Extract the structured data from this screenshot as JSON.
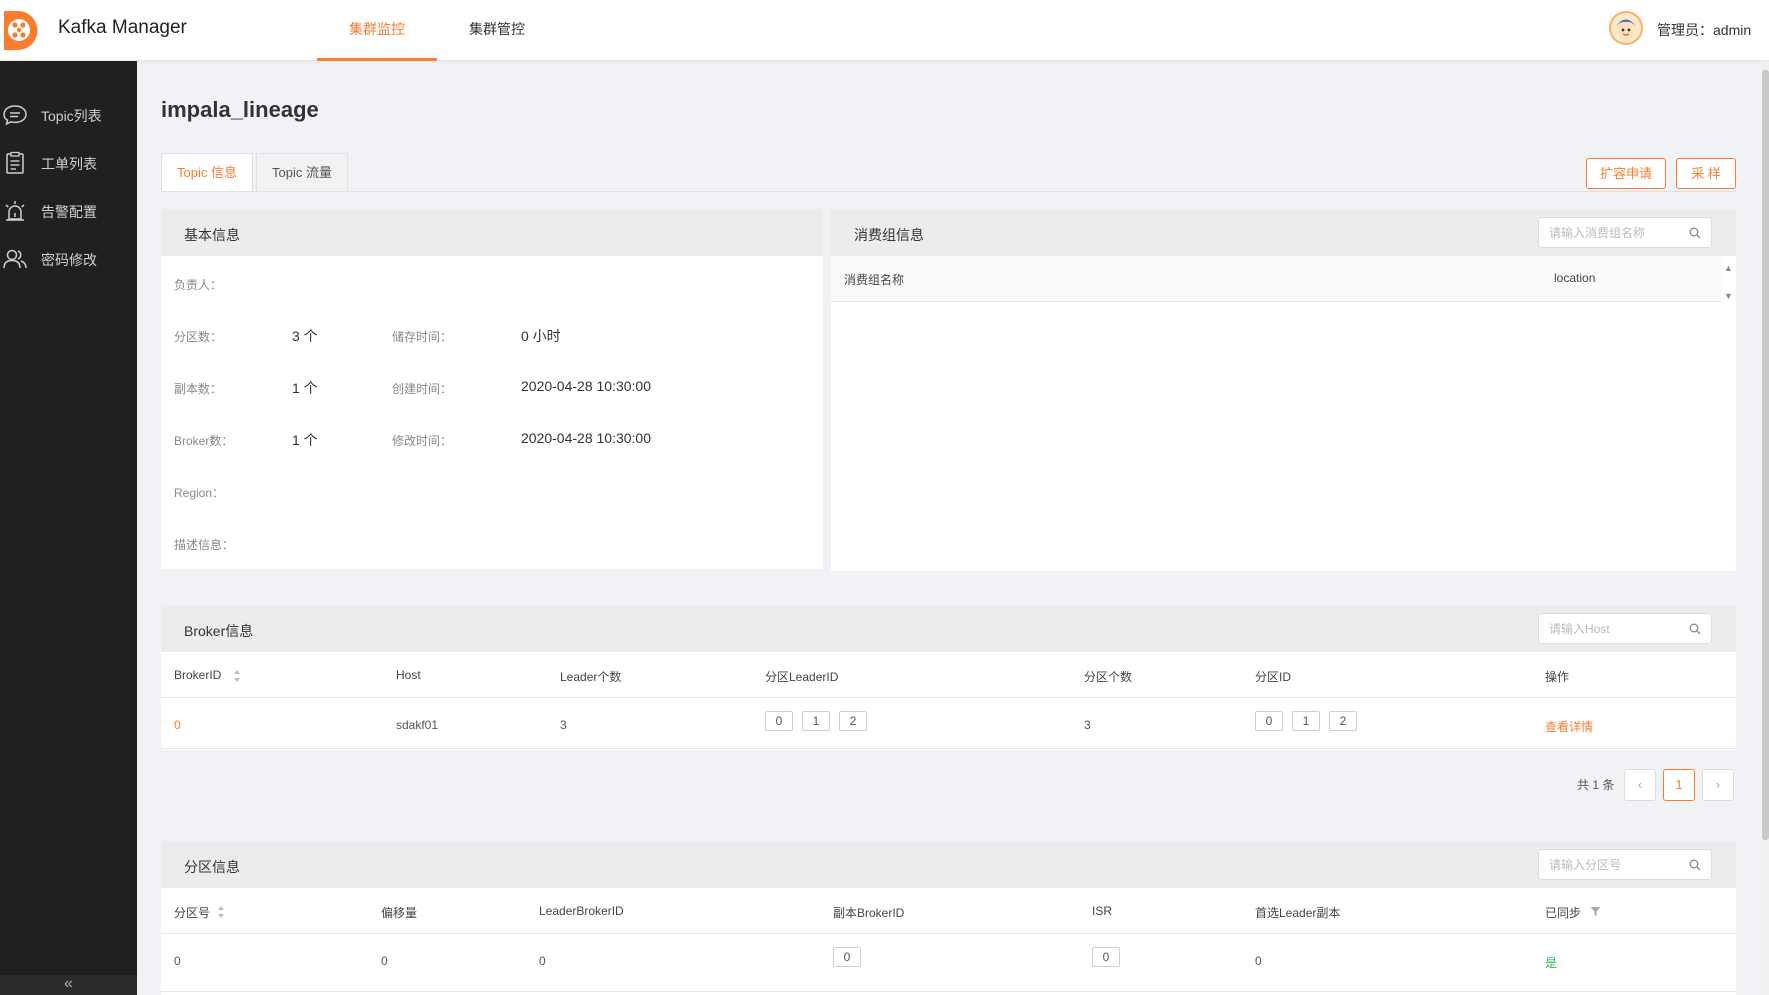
{
  "header": {
    "app_title": "Kafka Manager",
    "nav": [
      {
        "label": "集群监控",
        "active": true
      },
      {
        "label": "集群管控",
        "active": false
      }
    ],
    "user": "管理员：admin",
    "accent": "#fa7d2f"
  },
  "sidebar": {
    "items": [
      {
        "label": "Topic列表",
        "icon": "chat-bubble-icon"
      },
      {
        "label": "工单列表",
        "icon": "clipboard-icon"
      },
      {
        "label": "告警配置",
        "icon": "alarm-icon"
      },
      {
        "label": "密码修改",
        "icon": "users-icon"
      }
    ],
    "collapse": "«"
  },
  "page": {
    "title": "impala_lineage",
    "tabs": [
      "Topic 信息",
      "Topic 流量"
    ],
    "buttons": {
      "expand": "扩容申请",
      "sample": "采 样"
    }
  },
  "basic_info": {
    "title": "基本信息",
    "owner_label": "负责人：",
    "partitions_label": "分区数：",
    "partitions_value": "3 个",
    "retention_label": "储存时间：",
    "retention_value": "0 小时",
    "replicas_label": "副本数：",
    "replicas_value": "1 个",
    "created_label": "创建时间：",
    "created_value": "2020-04-28 10:30:00",
    "brokers_label": "Broker数：",
    "brokers_value": "1 个",
    "modified_label": "修改时间：",
    "modified_value": "2020-04-28 10:30:00",
    "region_label": "Region：",
    "desc_label": "描述信息："
  },
  "consumer_groups": {
    "title": "消费组信息",
    "search_placeholder": "请输入消费组名称",
    "columns": [
      "消费组名称",
      "location"
    ]
  },
  "broker_info": {
    "title": "Broker信息",
    "search_placeholder": "请输入Host",
    "columns": [
      "BrokerID",
      "Host",
      "Leader个数",
      "分区LeaderID",
      "分区个数",
      "分区ID",
      "操作"
    ],
    "rows": [
      {
        "broker_id": "0",
        "host": "sdakf01",
        "leader_count": "3",
        "leader_ids": [
          "0",
          "1",
          "2"
        ],
        "partition_count": "3",
        "partition_ids": [
          "0",
          "1",
          "2"
        ],
        "action": "查看详情"
      }
    ],
    "pagination": {
      "total": "共 1 条",
      "current": "1",
      "prev": "‹",
      "next": "›"
    }
  },
  "partition_info": {
    "title": "分区信息",
    "search_placeholder": "请输入分区号",
    "columns": [
      "分区号",
      "偏移量",
      "LeaderBrokerID",
      "副本BrokerID",
      "ISR",
      "首选Leader副本",
      "已同步"
    ],
    "rows": [
      {
        "partition": "0",
        "offset": "0",
        "leader_broker_id": "0",
        "replica_broker_id": "0",
        "isr": "0",
        "preferred_leader": "0",
        "synced": "是"
      }
    ]
  }
}
